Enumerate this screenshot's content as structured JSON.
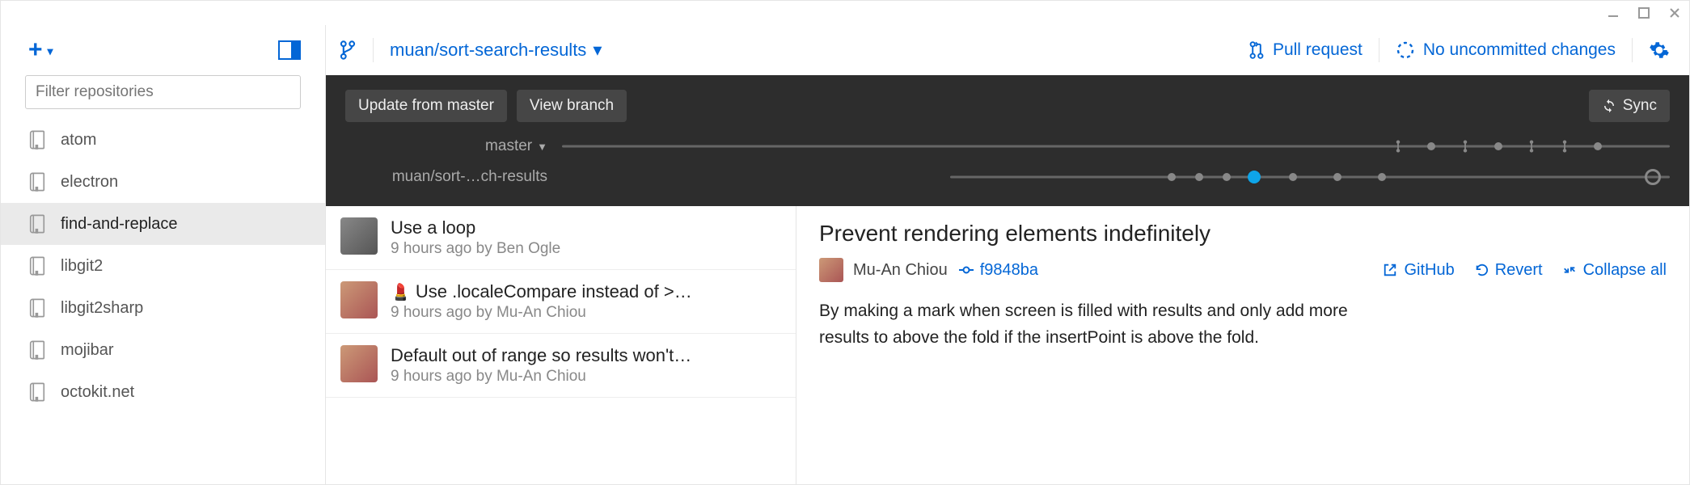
{
  "sidebar": {
    "filter_placeholder": "Filter repositories",
    "repos": [
      {
        "name": "atom",
        "active": false
      },
      {
        "name": "electron",
        "active": false
      },
      {
        "name": "find-and-replace",
        "active": true
      },
      {
        "name": "libgit2",
        "active": false
      },
      {
        "name": "libgit2sharp",
        "active": false
      },
      {
        "name": "mojibar",
        "active": false
      },
      {
        "name": "octokit.net",
        "active": false
      }
    ]
  },
  "header": {
    "repo_path": "muan/sort-search-results",
    "pull_request": "Pull request",
    "changes": "No uncommitted changes"
  },
  "graph": {
    "update_btn": "Update from master",
    "view_btn": "View branch",
    "sync": "Sync",
    "lanes": {
      "master": "master",
      "branch": "muan/sort-…ch-results"
    }
  },
  "commits": [
    {
      "title": "Use a loop",
      "emoji": "",
      "meta": "9 hours ago by Ben Ogle",
      "avatar": "a1"
    },
    {
      "title": "Use .localeCompare instead of >…",
      "emoji": "💄",
      "meta": "9 hours ago by Mu-An Chiou",
      "avatar": "a2"
    },
    {
      "title": "Default out of range so results won't…",
      "emoji": "",
      "meta": "9 hours ago by Mu-An Chiou",
      "avatar": "a2"
    }
  ],
  "detail": {
    "title": "Prevent rendering elements indefinitely",
    "author": "Mu-An Chiou",
    "sha": "f9848ba",
    "github": "GitHub",
    "revert": "Revert",
    "collapse": "Collapse all",
    "body": "By making a mark when screen is filled with results and only add more results to above the fold if the insertPoint is above the fold."
  },
  "colors": {
    "accent": "#0366d6"
  }
}
